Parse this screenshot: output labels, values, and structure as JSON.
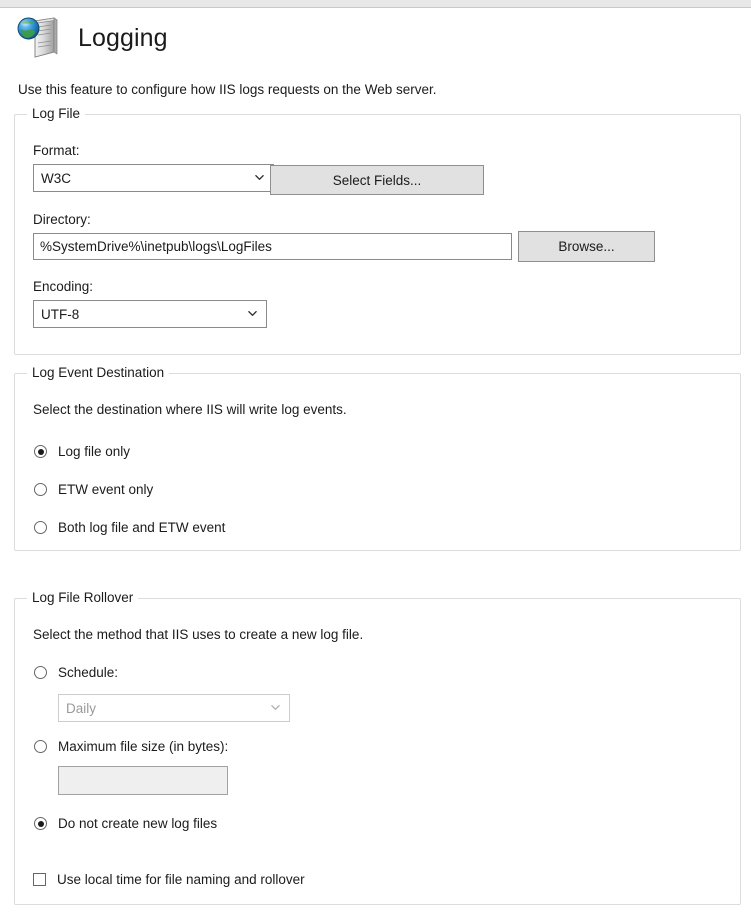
{
  "header": {
    "title": "Logging",
    "icon": "server-globe-icon"
  },
  "description": "Use this feature to configure how IIS logs requests on the Web server.",
  "log_file": {
    "legend": "Log File",
    "format_label": "Format:",
    "format_value": "W3C",
    "select_fields_button": "Select Fields...",
    "directory_label": "Directory:",
    "directory_value": "%SystemDrive%\\inetpub\\logs\\LogFiles",
    "browse_button": "Browse...",
    "encoding_label": "Encoding:",
    "encoding_value": "UTF-8"
  },
  "log_event_destination": {
    "legend": "Log Event Destination",
    "description": "Select the destination where IIS will write log events.",
    "options": [
      {
        "label": "Log file only",
        "checked": true
      },
      {
        "label": "ETW event only",
        "checked": false
      },
      {
        "label": "Both log file and ETW event",
        "checked": false
      }
    ]
  },
  "log_file_rollover": {
    "legend": "Log File Rollover",
    "description": "Select the method that IIS uses to create a new log file.",
    "options": [
      {
        "label": "Schedule:",
        "checked": false
      },
      {
        "label": "Maximum file size (in bytes):",
        "checked": false
      },
      {
        "label": "Do not create new log files",
        "checked": true
      }
    ],
    "schedule_value": "Daily",
    "schedule_disabled": true,
    "max_file_size_value": "",
    "max_file_size_disabled": true,
    "local_time_checkbox": {
      "label": "Use local time for file naming and rollover",
      "checked": false
    }
  },
  "colors": {
    "text": "#1b1b1b",
    "group_border": "#dcdcdc",
    "button_face": "#e1e1e1",
    "disabled_text": "#9a9a9a"
  }
}
